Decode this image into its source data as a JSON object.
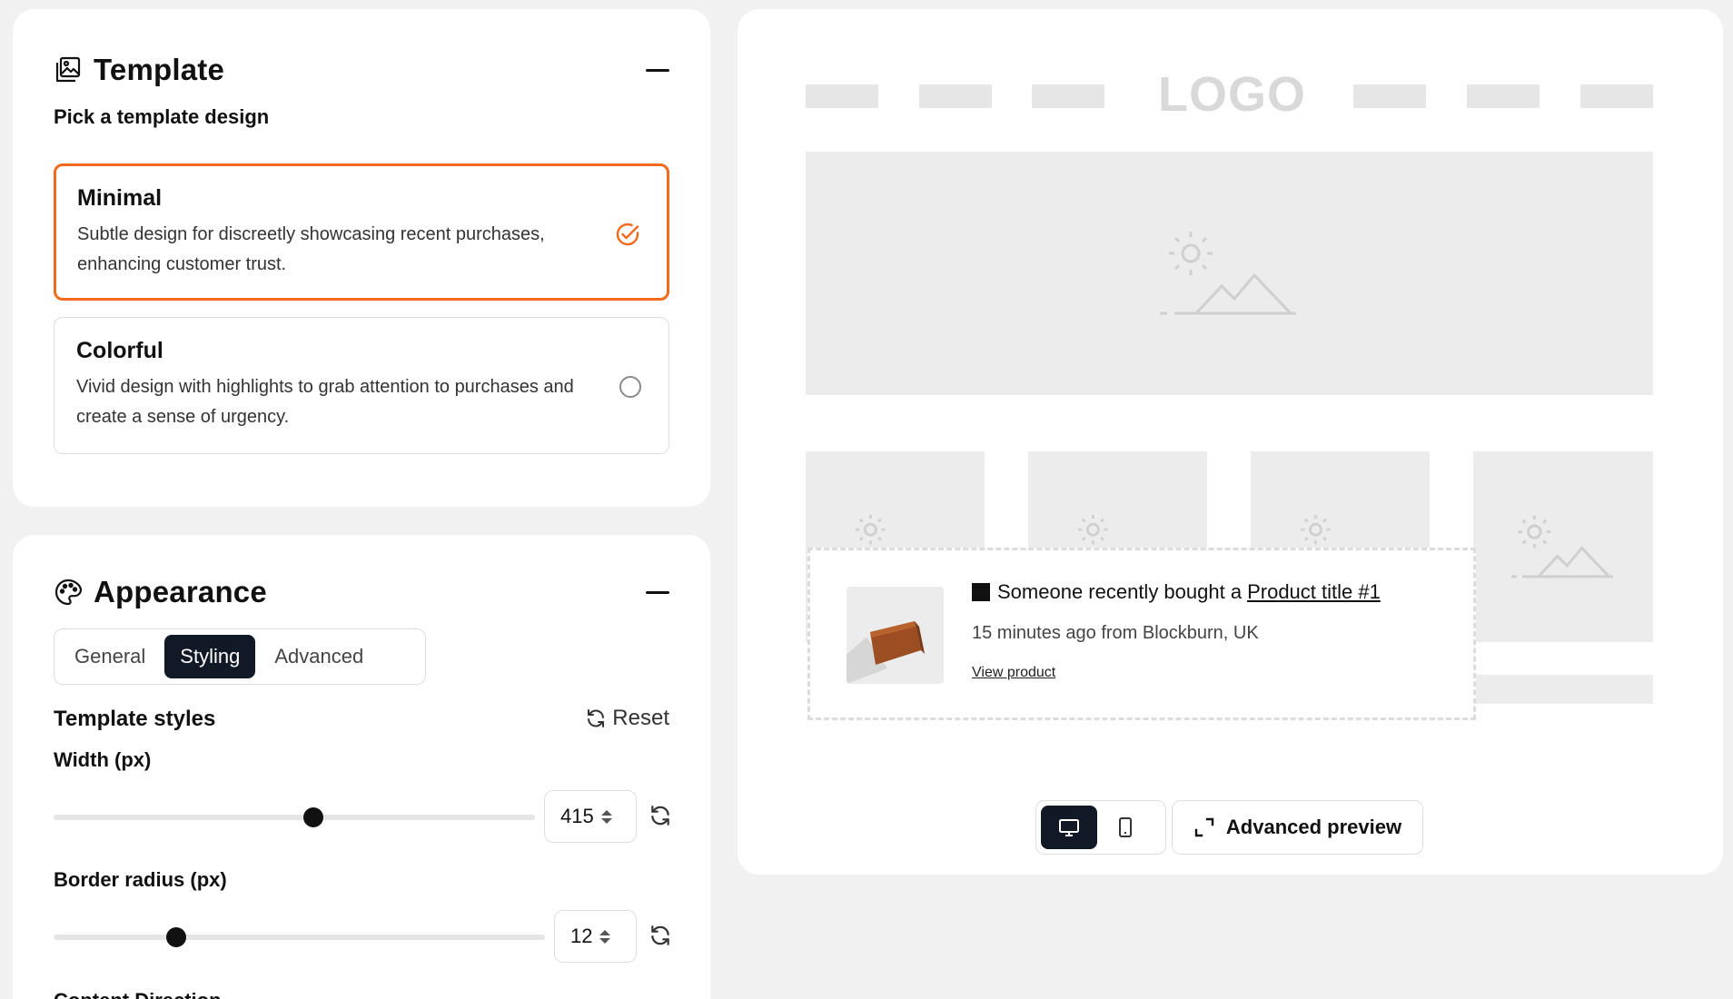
{
  "template_section": {
    "title": "Template",
    "subtitle": "Pick a template design",
    "options": [
      {
        "title": "Minimal",
        "description": "Subtle design for discreetly showcasing recent purchases, enhancing customer trust.",
        "selected": true
      },
      {
        "title": "Colorful",
        "description": "Vivid design with highlights to grab attention to purchases and create a sense of urgency.",
        "selected": false
      }
    ]
  },
  "appearance_section": {
    "title": "Appearance",
    "tabs": [
      "General",
      "Styling",
      "Advanced"
    ],
    "active_tab": "Styling",
    "styles_title": "Template styles",
    "reset_label": "Reset",
    "width": {
      "label": "Width (px)",
      "value": "415",
      "slider_fraction": 0.54
    },
    "border_radius": {
      "label": "Border radius (px)",
      "value": "12",
      "slider_fraction": 0.25
    },
    "next_label": "Content Direction"
  },
  "preview": {
    "logo_text": "LOGO",
    "notification": {
      "prefix": "Someone recently bought a",
      "product_link": "Product title #1",
      "meta": "15 minutes ago from Blockburn, UK",
      "view_link": "View product"
    },
    "advanced_preview_label": "Advanced preview",
    "active_device": "desktop"
  },
  "colors": {
    "accent": "#f26a1b",
    "dark": "#111826",
    "placeholder": "#ececec"
  },
  "icons": {
    "template": "template-icon",
    "appearance": "palette-icon",
    "selected": "check-circle-icon",
    "reset": "refresh-icon",
    "desktop": "desktop-icon",
    "mobile": "mobile-icon",
    "expand": "expand-icon"
  }
}
